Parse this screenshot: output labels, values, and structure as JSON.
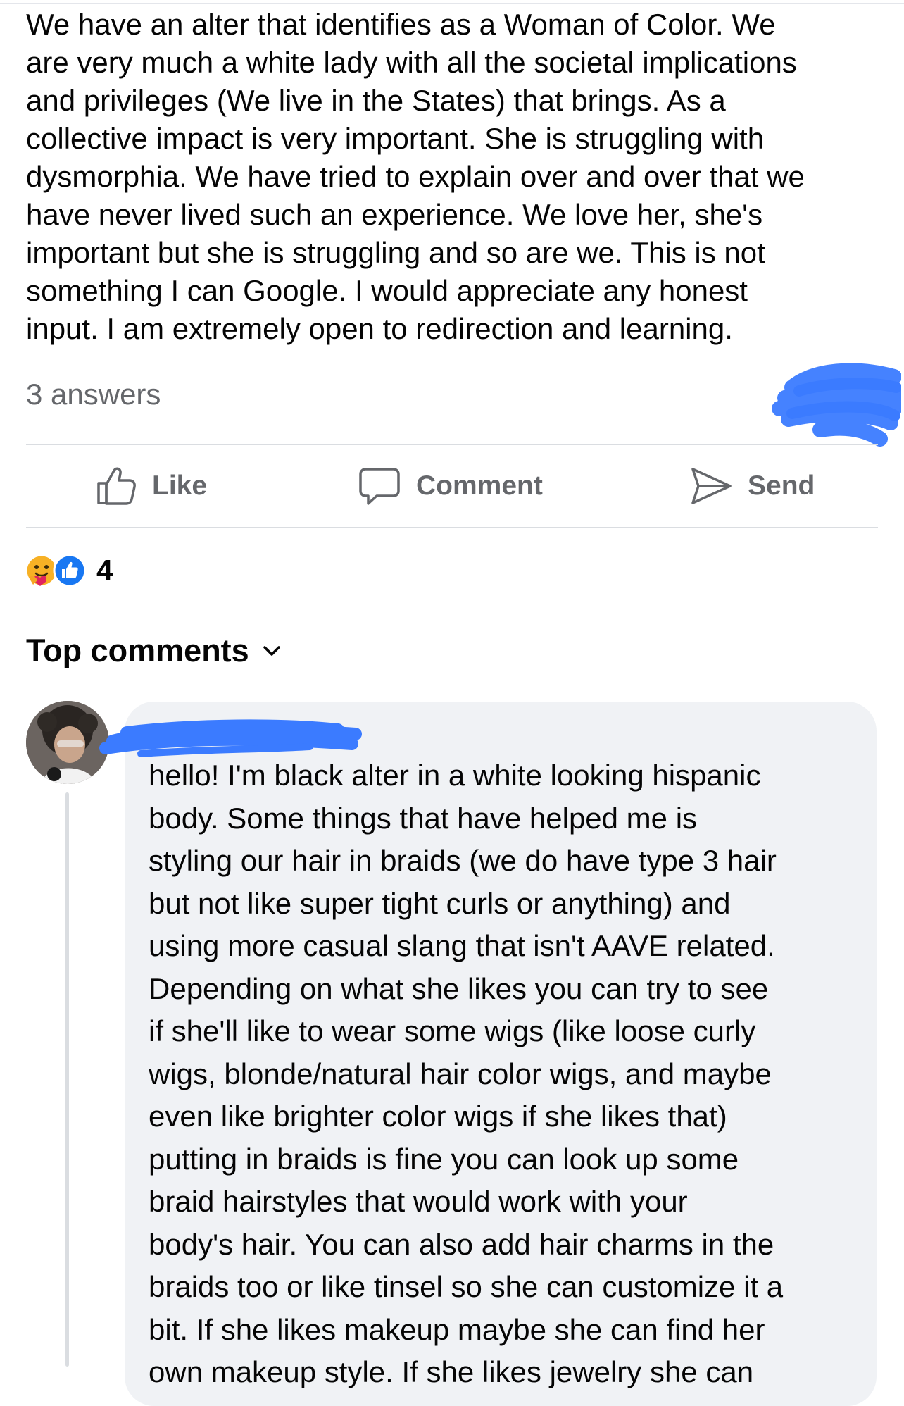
{
  "post": {
    "lines": [
      "We have an alter that identifies as a Woman of Color. We",
      "are very much a white lady with all the societal implications",
      "and privileges (We live in the States) that brings.  As a",
      "collective impact is very important.  She is struggling with",
      "dysmorphia. We have tried to explain over and over that we",
      "have never lived such an experience.  We love her, she's",
      "important but she is struggling and so are we. This is not",
      "something I can Google.  I would appreciate any honest",
      "input.  I am extremely open to redirection and learning."
    ],
    "answers_count": "3 answers"
  },
  "actions": {
    "like_label": "Like",
    "comment_label": "Comment",
    "send_label": "Send"
  },
  "reactions": {
    "count": "4",
    "types": [
      "care",
      "like"
    ]
  },
  "comments_section": {
    "sort_label": "Top comments"
  },
  "comment": {
    "author_name": "",
    "lines": [
      "hello! I'm black alter in a white looking hispanic",
      "body. Some things that have helped me is",
      "styling our hair in braids (we do have type 3 hair",
      "but not like super tight curls or anything) and",
      "using more casual slang that isn't AAVE related.",
      "Depending on what she likes you can try to see",
      "if she'll like to wear some wigs (like loose curly",
      "wigs, blonde/natural hair color wigs, and maybe",
      "even like brighter color wigs if she likes that)",
      "putting in braids is fine you can look up some",
      "braid hairstyles that would work with your",
      "body's hair. You can also add hair charms in the",
      "braids too or like tinsel so she can customize it a",
      "bit. If she likes makeup maybe she can find her",
      "own makeup style. If she likes jewelry she can"
    ]
  },
  "colors": {
    "text_primary": "#050505",
    "text_secondary": "#65676b",
    "divider": "#dadde1",
    "bubble_bg": "#f0f2f5",
    "redaction_blue": "#3b7bff",
    "like_blue": "#1877f2"
  }
}
